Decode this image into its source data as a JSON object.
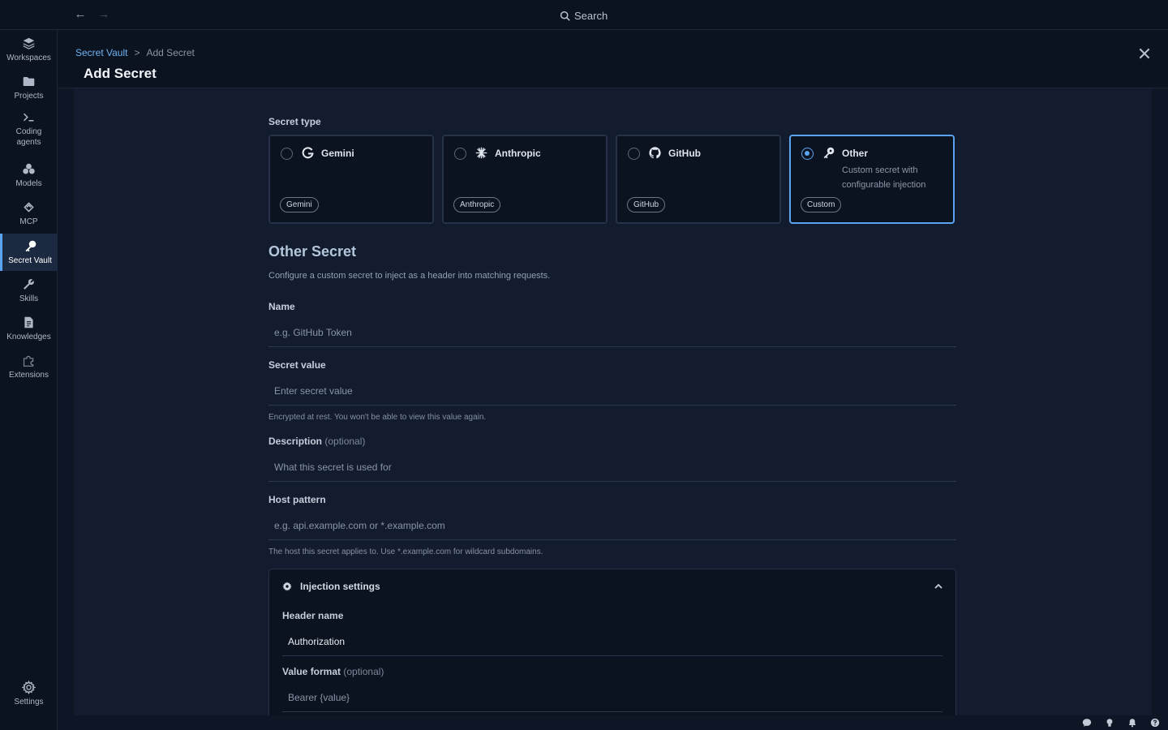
{
  "topbar": {
    "search_label": "Search"
  },
  "sidebar": {
    "items": [
      {
        "label": "Workspaces",
        "icon": "layers-icon"
      },
      {
        "label": "Projects",
        "icon": "folder-icon"
      },
      {
        "label": "Coding agents",
        "icon": "terminal-icon"
      },
      {
        "label": "Models",
        "icon": "cubes-icon"
      },
      {
        "label": "MCP",
        "icon": "mcp-icon"
      },
      {
        "label": "Secret Vault",
        "icon": "key-icon",
        "active": true
      },
      {
        "label": "Skills",
        "icon": "wrench-icon"
      },
      {
        "label": "Knowledges",
        "icon": "document-icon"
      },
      {
        "label": "Extensions",
        "icon": "puzzle-icon"
      }
    ],
    "settings_label": "Settings"
  },
  "header": {
    "breadcrumb_root": "Secret Vault",
    "breadcrumb_sep": ">",
    "breadcrumb_current": "Add Secret",
    "title": "Add Secret"
  },
  "form": {
    "secret_type_label": "Secret type",
    "types": [
      {
        "title": "Gemini",
        "badge": "Gemini",
        "desc": "",
        "icon": "google-icon"
      },
      {
        "title": "Anthropic",
        "badge": "Anthropic",
        "desc": "",
        "icon": "anthropic-icon"
      },
      {
        "title": "GitHub",
        "badge": "GitHub",
        "desc": "",
        "icon": "github-icon"
      },
      {
        "title": "Other",
        "badge": "Custom",
        "desc": "Custom secret with configurable injection",
        "icon": "key-icon",
        "selected": true
      }
    ],
    "section_title": "Other Secret",
    "section_desc": "Configure a custom secret to inject as a header into matching requests.",
    "name": {
      "label": "Name",
      "placeholder": "e.g. GitHub Token"
    },
    "secret_value": {
      "label": "Secret value",
      "placeholder": "Enter secret value",
      "help": "Encrypted at rest. You won't be able to view this value again."
    },
    "description": {
      "label": "Description",
      "optional": "(optional)",
      "placeholder": "What this secret is used for"
    },
    "host_pattern": {
      "label": "Host pattern",
      "placeholder": "e.g. api.example.com or *.example.com",
      "help": "The host this secret applies to. Use *.example.com for wildcard subdomains."
    },
    "injection": {
      "title": "Injection settings",
      "header_name": {
        "label": "Header name",
        "value": "Authorization"
      },
      "value_format": {
        "label": "Value format",
        "optional": "(optional)",
        "value": "Bearer {value}"
      }
    }
  },
  "colors": {
    "accent": "#5aa3f0",
    "background": "#0e1625",
    "panel": "#121c2e"
  }
}
